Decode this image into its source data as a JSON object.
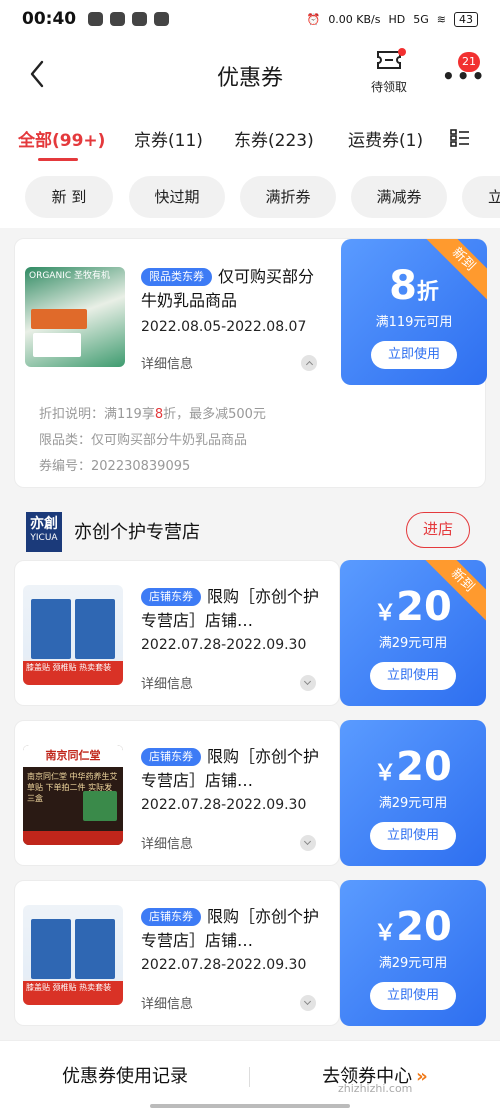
{
  "status_bar": {
    "time": "00:40",
    "net_speed": "0.00 KB/s",
    "signal": "5G",
    "battery": "43"
  },
  "header": {
    "title": "优惠券",
    "pending_label": "待领取",
    "more_badge": "21"
  },
  "tabs": [
    {
      "label": "全部(99+)",
      "active": true
    },
    {
      "label": "京券(11)"
    },
    {
      "label": "东券(223)"
    },
    {
      "label": "运费券(1)"
    }
  ],
  "chips": [
    "新  到",
    "快过期",
    "满折券",
    "满减券",
    "立"
  ],
  "coupons": [
    {
      "tag": "限品类东券",
      "title": "仅可购买部分牛奶乳品商品",
      "date": "2022.08.05-2022.08.07",
      "detail_label": "详细信息",
      "amount_value": "8",
      "amount_unit": "折",
      "condition": "满119元可用",
      "use_label": "立即使用",
      "ribbon": "新到",
      "thumb_text": "ORGANIC 圣牧有机",
      "explain_prefix": "折扣说明：满119享",
      "explain_highlight": "8",
      "explain_suffix": "折，最多减500元",
      "category_line": "限品类：仅可购买部分牛奶乳品商品",
      "serial_line": "券编号：202230839095"
    },
    {
      "tag": "店铺东券",
      "title": "限购［亦创个护专营店］店铺…",
      "date": "2022.07.28-2022.09.30",
      "detail_label": "详细信息",
      "amount_value": "20",
      "amount_unit": "￥",
      "condition": "满29元可用",
      "use_label": "立即使用",
      "ribbon": "新到",
      "thumb_text": "膝盖贴 颈椎贴 热卖套装"
    },
    {
      "tag": "店铺东券",
      "title": "限购［亦创个护专营店］店铺…",
      "date": "2022.07.28-2022.09.30",
      "detail_label": "详细信息",
      "amount_value": "20",
      "amount_unit": "￥",
      "condition": "满29元可用",
      "use_label": "立即使用",
      "thumb_text": "南京同仁堂 中华药养生艾草贴 下单拍二件 实际发三盒"
    },
    {
      "tag": "店铺东券",
      "title": "限购［亦创个护专营店］店铺…",
      "date": "2022.07.28-2022.09.30",
      "detail_label": "详细信息",
      "amount_value": "20",
      "amount_unit": "￥",
      "condition": "满29元可用",
      "use_label": "立即使用",
      "thumb_text": "膝盖贴 颈椎贴 热卖套装"
    }
  ],
  "shop": {
    "name": "亦创个护专营店",
    "logo_text": "YICUA",
    "enter_label": "进店"
  },
  "bottom": {
    "left_label": "优惠券使用记录",
    "right_label": "去领券中心",
    "right_arrows": "»"
  },
  "watermark": "zhizhizhi.com",
  "colors": {
    "accent_red": "#e4393c",
    "coupon_blue": "#2e6ff0",
    "ribbon_orange": "#ff9a2e"
  }
}
